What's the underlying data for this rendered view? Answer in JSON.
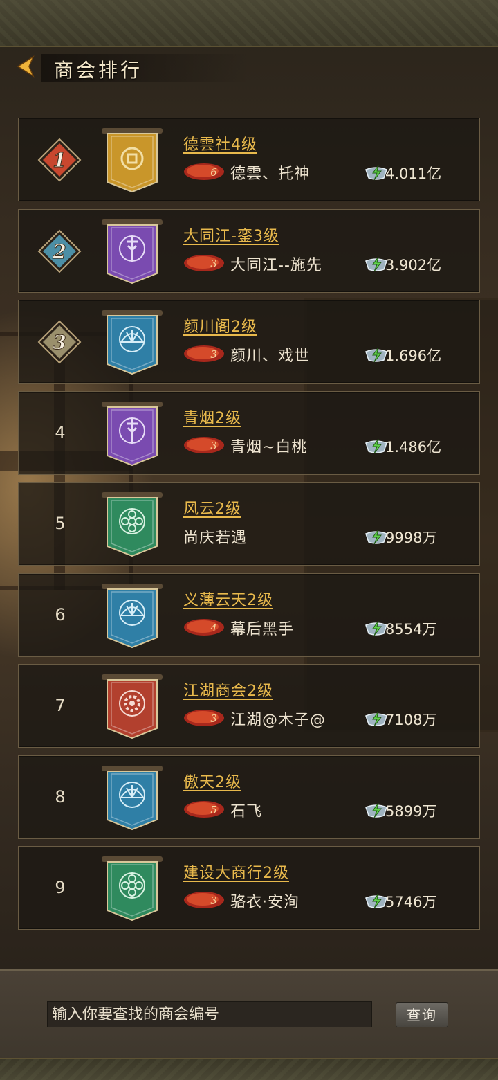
{
  "header": {
    "title": "商会排行"
  },
  "icons": {
    "back": "back-arrow-icon",
    "wealth": "silver-ingot-icon"
  },
  "colors": {
    "guild_name": "#e8b94c",
    "rank1": "#c8472e",
    "rank2": "#4c8fa6",
    "rank3": "#9a8f6c",
    "banner_gold": "#c9962a",
    "banner_purple": "#7a4bb0",
    "banner_blue": "#2f7fa6",
    "banner_green": "#2f8a5e",
    "banner_red": "#b2402e"
  },
  "rows": [
    {
      "rank": "1",
      "name": "德雲社4级",
      "vip": "6",
      "leader": "德雲、托神",
      "wealth": "4.011亿",
      "banner": "gold",
      "emblem": "coin"
    },
    {
      "rank": "2",
      "name": "大同江-銮3级",
      "vip": "3",
      "leader": "大同江--施先",
      "wealth": "3.902亿",
      "banner": "purple",
      "emblem": "sword"
    },
    {
      "rank": "3",
      "name": "颜川阁2级",
      "vip": "3",
      "leader": "颜川、戏世",
      "wealth": "1.696亿",
      "banner": "blue",
      "emblem": "fan"
    },
    {
      "rank": "4",
      "name": "青烟2级",
      "vip": "3",
      "leader": "青烟~白桃",
      "wealth": "1.486亿",
      "banner": "purple",
      "emblem": "sword"
    },
    {
      "rank": "5",
      "name": "风云2级",
      "vip": "",
      "leader": "尚庆若遇",
      "wealth": "9998万",
      "banner": "green",
      "emblem": "flower"
    },
    {
      "rank": "6",
      "name": "义薄云天2级",
      "vip": "4",
      "leader": "幕后黑手",
      "wealth": "8554万",
      "banner": "blue",
      "emblem": "fan"
    },
    {
      "rank": "7",
      "name": "江湖商会2级",
      "vip": "3",
      "leader": "江湖@木子@",
      "wealth": "7108万",
      "banner": "red",
      "emblem": "gear"
    },
    {
      "rank": "8",
      "name": "傲天2级",
      "vip": "5",
      "leader": "石飞",
      "wealth": "5899万",
      "banner": "blue",
      "emblem": "fan"
    },
    {
      "rank": "9",
      "name": "建设大商行2级",
      "vip": "3",
      "leader": "骆衣·安洵",
      "wealth": "5746万",
      "banner": "green",
      "emblem": "flower"
    }
  ],
  "search": {
    "placeholder": "输入你要查找的商会编号",
    "button": "查询"
  }
}
